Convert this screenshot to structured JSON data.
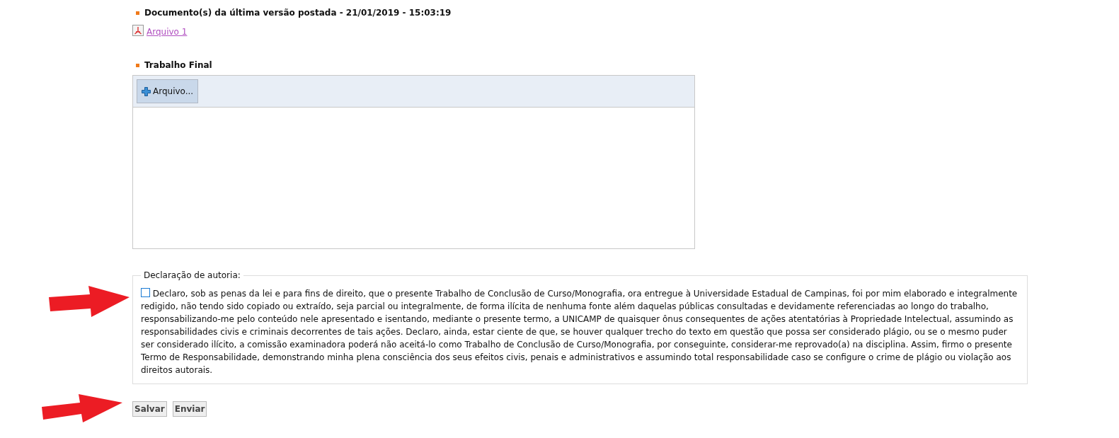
{
  "last_version": {
    "heading": "Documento(s) da última versão postada - 21/01/2019 - 15:03:19",
    "files": [
      "Arquivo 1"
    ]
  },
  "final_work": {
    "heading": "Trabalho Final",
    "add_button": "Arquivo..."
  },
  "declaration": {
    "legend": "Declaração de autoria:",
    "checked": false,
    "text": "Declaro, sob as penas da lei e para fins de direito, que o presente Trabalho de Conclusão de Curso/Monografia, ora entregue à Universidade Estadual de Campinas, foi por mim elaborado e integralmente redigido, não tendo sido copiado ou extraído, seja parcial ou integralmente, de forma ilícita de nenhuma fonte além daquelas públicas consultadas e devidamente referenciadas ao longo do trabalho, responsabilizando-me pelo conteúdo nele apresentado e isentando, mediante o presente termo, a UNICAMP de quaisquer ônus consequentes de ações atentatórias à Propriedade Intelectual, assumindo as responsabilidades civis e criminais decorrentes de tais ações. Declaro, ainda, estar ciente de que, se houver qualquer trecho do texto em questão que possa ser considerado plágio, ou se o mesmo puder ser considerado ilícito, a comissão examinadora poderá não aceitá-lo como Trabalho de Conclusão de Curso/Monografia, por conseguinte, considerar-me reprovado(a) na disciplina. Assim, firmo o presente Termo de Responsabilidade, demonstrando minha plena consciência dos seus efeitos civis, penais e administrativos e assumindo total responsabilidade caso se configure o crime de plágio ou violação aos direitos autorais."
  },
  "buttons": [
    "Salvar",
    "Enviar"
  ]
}
